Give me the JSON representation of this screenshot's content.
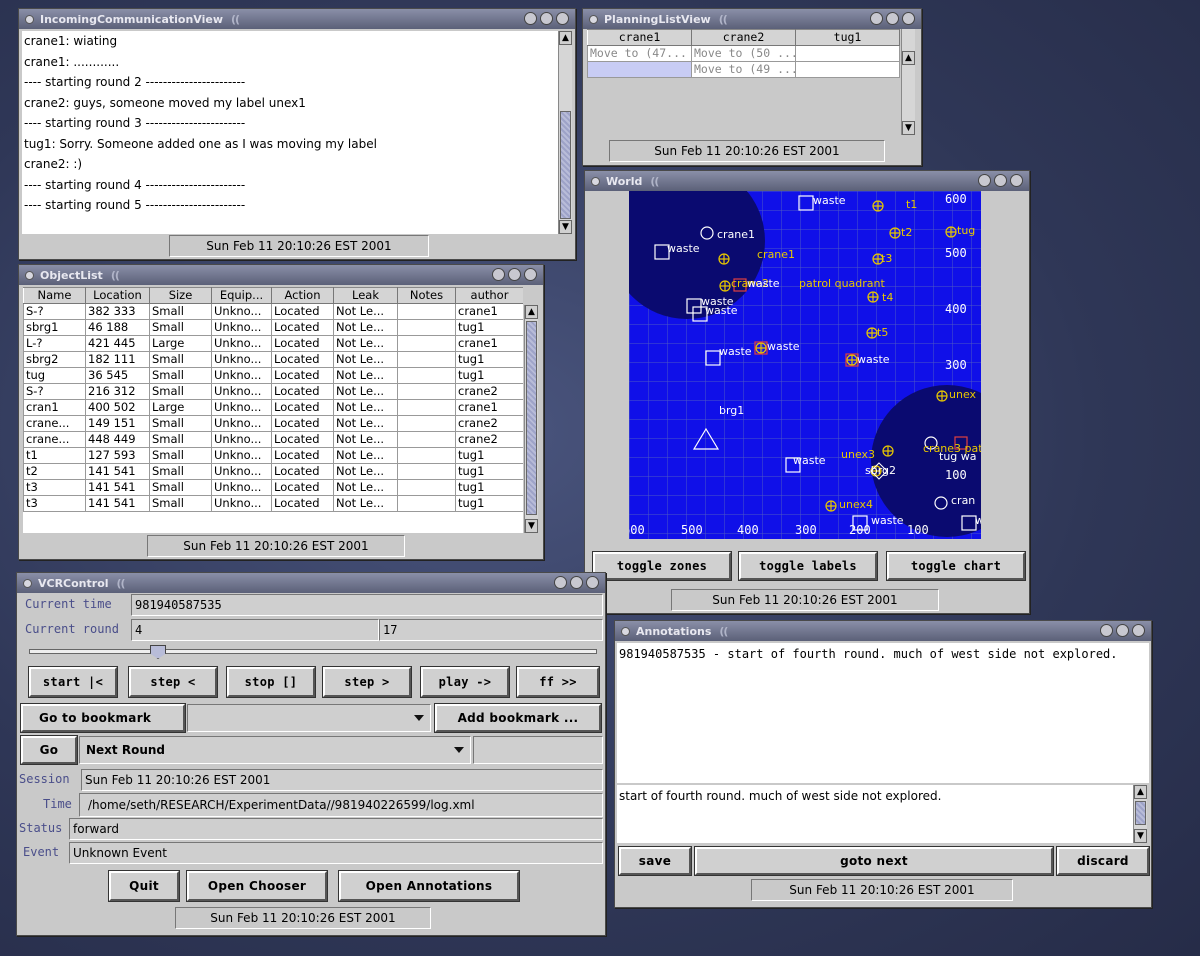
{
  "incoming": {
    "title": "IncomingCommunicationView",
    "messages": [
      "crane1: wiating",
      "crane1: ............",
      "---- starting round 2 -----------------------",
      "crane2: guys, someone moved my label unex1",
      "---- starting round 3 -----------------------",
      "tug1: Sorry.  Someone added one as I was moving my label",
      "crane2: :)",
      "---- starting round 4 -----------------------",
      "---- starting round 5 -----------------------"
    ],
    "status": "Sun Feb 11 20:10:26 EST 2001"
  },
  "planning": {
    "title": "PlanningListView",
    "columns": [
      "crane1",
      "crane2",
      "tug1"
    ],
    "rows": [
      [
        "Move to (47...",
        "Move to (50 ...",
        ""
      ],
      [
        "",
        "Move to (49 ...",
        ""
      ]
    ],
    "status": "Sun Feb 11 20:10:26 EST 2001"
  },
  "objectlist": {
    "title": "ObjectList",
    "columns": [
      "Name",
      "Location",
      "Size",
      "Equip...",
      "Action",
      "Leak",
      "Notes",
      "author"
    ],
    "rows": [
      [
        "S-?",
        "382 333",
        "Small",
        "Unkno...",
        "Located",
        "Not Le...",
        "",
        "crane1"
      ],
      [
        "sbrg1",
        "46 188",
        "Small",
        "Unkno...",
        "Located",
        "Not Le...",
        "",
        "tug1"
      ],
      [
        "L-?",
        "421 445",
        "Large",
        "Unkno...",
        "Located",
        "Not Le...",
        "",
        "crane1"
      ],
      [
        "sbrg2",
        "182 111",
        "Small",
        "Unkno...",
        "Located",
        "Not Le...",
        "",
        "tug1"
      ],
      [
        "tug",
        "36 545",
        "Small",
        "Unkno...",
        "Located",
        "Not Le...",
        "",
        "tug1"
      ],
      [
        "S-?",
        "216 312",
        "Small",
        "Unkno...",
        "Located",
        "Not Le...",
        "",
        "crane2"
      ],
      [
        "cran1",
        "400 502",
        "Large",
        "Unkno...",
        "Located",
        "Not Le...",
        "",
        "crane1"
      ],
      [
        "crane...",
        "149 151",
        "Small",
        "Unkno...",
        "Located",
        "Not Le...",
        "",
        "crane2"
      ],
      [
        "crane...",
        "448 449",
        "Small",
        "Unkno...",
        "Located",
        "Not Le...",
        "",
        "crane2"
      ],
      [
        "t1",
        "127 593",
        "Small",
        "Unkno...",
        "Located",
        "Not Le...",
        "",
        "tug1"
      ],
      [
        "t2",
        "141 541",
        "Small",
        "Unkno...",
        "Located",
        "Not Le...",
        "",
        "tug1"
      ],
      [
        "t3",
        "141 541",
        "Small",
        "Unkno...",
        "Located",
        "Not Le...",
        "",
        "tug1"
      ],
      [
        "t3",
        "141 541",
        "Small",
        "Unkno...",
        "Located",
        "Not Le...",
        "",
        "tug1"
      ]
    ],
    "status": "Sun Feb 11 20:10:26 EST 2001"
  },
  "world": {
    "title": "World",
    "y_ticks": [
      "600",
      "500",
      "400",
      "300",
      "100"
    ],
    "x_ticks": [
      "600",
      "500",
      "400",
      "300",
      "200",
      "100"
    ],
    "labels": [
      {
        "t": "waste",
        "c": "#ffffff"
      },
      {
        "t": "crane1",
        "c": "#ffffff"
      },
      {
        "t": "waste",
        "c": "#ffffff"
      },
      {
        "t": "crane1",
        "c": "#e8c800"
      },
      {
        "t": "t1",
        "c": "#e8c800"
      },
      {
        "t": "t2",
        "c": "#e8c800"
      },
      {
        "t": "tug",
        "c": "#e8c800"
      },
      {
        "t": "t3",
        "c": "#e8c800"
      },
      {
        "t": "crane2",
        "c": "#e8c800"
      },
      {
        "t": "waste",
        "c": "#ffffff"
      },
      {
        "t": "patrol quadrant",
        "c": "#e8c800"
      },
      {
        "t": "t4",
        "c": "#e8c800"
      },
      {
        "t": "waste",
        "c": "#ffffff"
      },
      {
        "t": "waste",
        "c": "#ffffff"
      },
      {
        "t": "t5",
        "c": "#e8c800"
      },
      {
        "t": "waste",
        "c": "#ffffff"
      },
      {
        "t": "waste",
        "c": "#ffffff"
      },
      {
        "t": "waste",
        "c": "#ffffff"
      },
      {
        "t": "brg1",
        "c": "#ffffff"
      },
      {
        "t": "unex",
        "c": "#e8c800"
      },
      {
        "t": "unex3",
        "c": "#e8c800"
      },
      {
        "t": "crane3 patro",
        "c": "#e8c800"
      },
      {
        "t": "tug wa",
        "c": "#ffffff"
      },
      {
        "t": "waste",
        "c": "#ffffff"
      },
      {
        "t": "sbrg2",
        "c": "#ffffff"
      },
      {
        "t": "unex4",
        "c": "#e8c800"
      },
      {
        "t": "cran",
        "c": "#ffffff"
      },
      {
        "t": "waste",
        "c": "#ffffff"
      },
      {
        "t": "w",
        "c": "#ffffff"
      }
    ],
    "buttons": [
      "toggle zones",
      "toggle labels",
      "toggle chart"
    ],
    "status": "Sun Feb 11 20:10:26 EST 2001"
  },
  "vcr": {
    "title": "VCRControl",
    "current_time_label": "Current time",
    "current_time": "981940587535",
    "current_round_label": "Current round",
    "current_round": "4",
    "total_rounds": "17",
    "slider_value": 0.22,
    "buttons": [
      "start |<",
      "step <",
      "stop []",
      "step >",
      "play ->",
      "ff >>"
    ],
    "goto_bookmark": "Go to bookmark",
    "bookmark_value": "",
    "add_bookmark": "Add bookmark ...",
    "go": "Go",
    "go_target": "Next Round",
    "session_label": "Session",
    "session": "Sun Feb 11 20:10:26 EST 2001",
    "time_label": "Time",
    "time": "/home/seth/RESEARCH/ExperimentData//981940226599/log.xml",
    "status_label": "Status",
    "status_value": "forward",
    "event_label": "Event",
    "event": "Unknown Event",
    "quit": "Quit",
    "open_chooser": "Open Chooser",
    "open_annotations": "Open Annotations",
    "status": "Sun Feb 11 20:10:26 EST 2001"
  },
  "annotations": {
    "title": "Annotations",
    "list": [
      "981940587535 - start of fourth round.  much of west side not explored."
    ],
    "edit_text": "start of fourth round.  much of west side not explored.",
    "save": "save",
    "goto_next": "goto next",
    "discard": "discard",
    "status": "Sun Feb 11 20:10:26 EST 2001"
  }
}
